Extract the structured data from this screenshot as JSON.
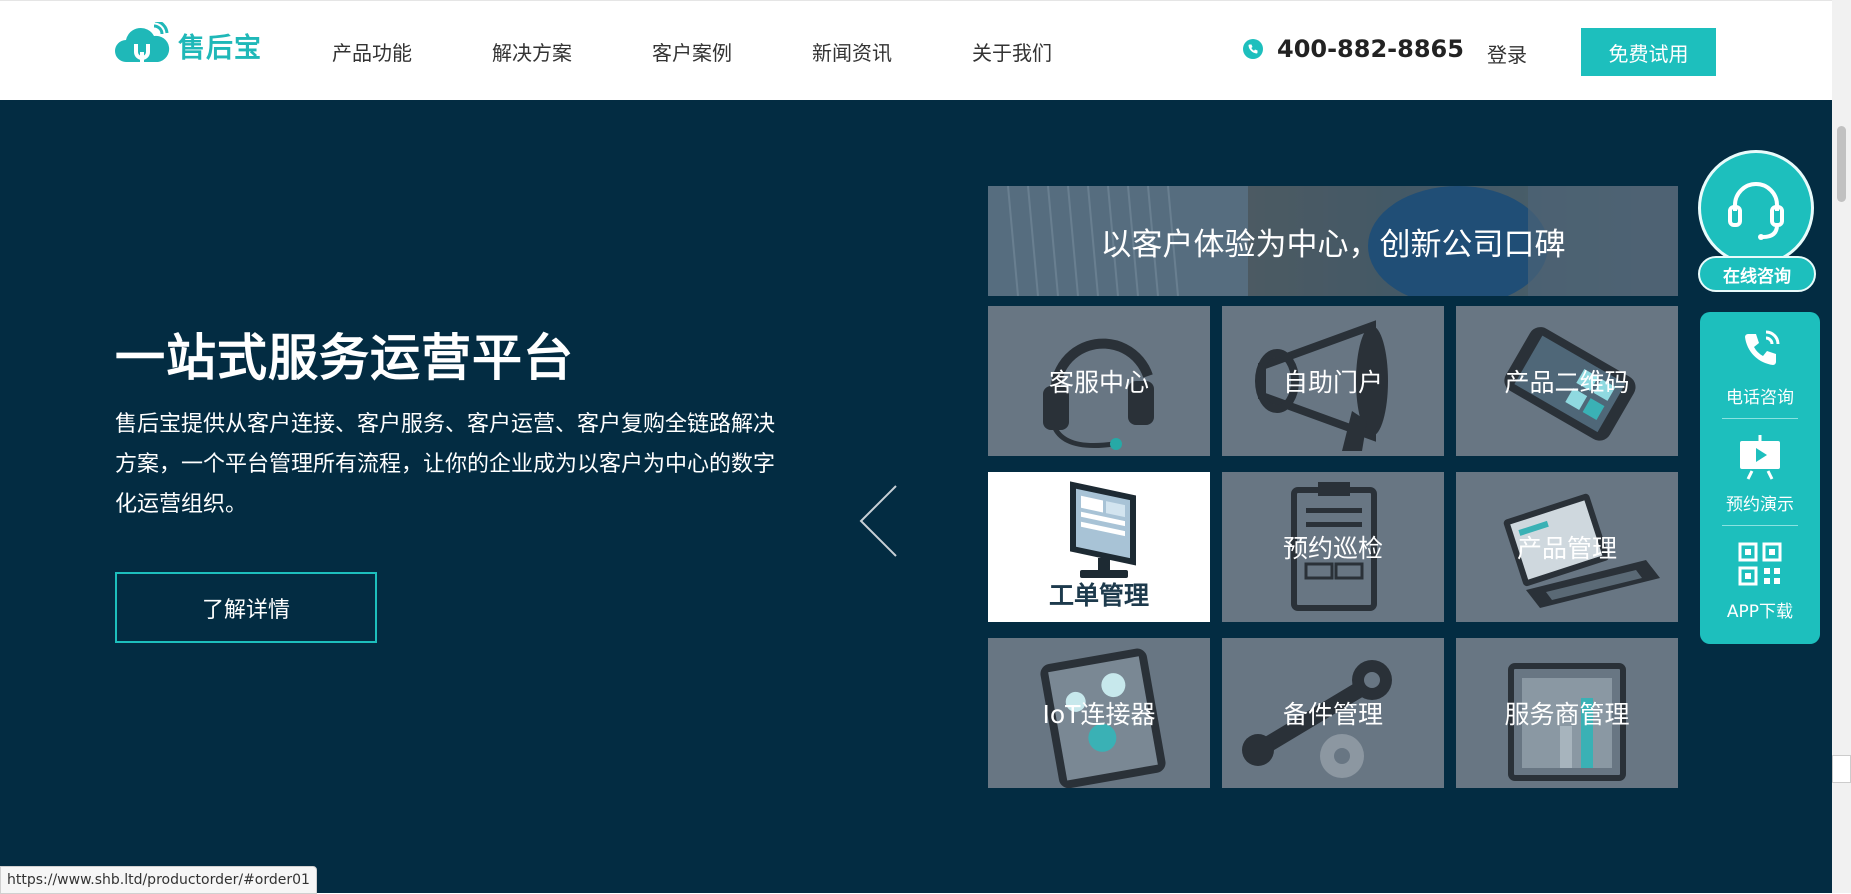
{
  "header": {
    "logo_text": "售后宝",
    "nav": [
      "产品功能",
      "解决方案",
      "客户案例",
      "新闻资讯",
      "关于我们"
    ],
    "phone": "400-882-8865",
    "login": "登录",
    "trial_button": "免费试用"
  },
  "hero": {
    "title": "一站式服务运营平台",
    "description": "售后宝提供从客户连接、客户服务、客户运营、客户复购全链路解决方案，一个平台管理所有流程，让你的企业成为以客户为中心的数字化运营组织。",
    "learn_more": "了解详情"
  },
  "banner": {
    "text": "以客户体验为中心，创新公司口碑"
  },
  "tiles": [
    {
      "label": "客服中心",
      "icon": "headset-icon"
    },
    {
      "label": "自助门户",
      "icon": "megaphone-icon"
    },
    {
      "label": "产品二维码",
      "icon": "phone-qr-icon"
    },
    {
      "label": "工单管理",
      "icon": "monitor-icon",
      "active": true
    },
    {
      "label": "预约巡检",
      "icon": "clipboard-icon"
    },
    {
      "label": "产品管理",
      "icon": "laptop-icon"
    },
    {
      "label": "IoT连接器",
      "icon": "tablet-icon"
    },
    {
      "label": "备件管理",
      "icon": "wrench-gear-icon"
    },
    {
      "label": "服务商管理",
      "icon": "chart-frame-icon"
    }
  ],
  "floating": {
    "consult": "在线咨询",
    "phone_consult": "电话咨询",
    "demo": "预约演示",
    "app_download": "APP下载"
  },
  "status_bar": {
    "url": "https://www.shb.ltd/productorder/#order01"
  },
  "colors": {
    "accent": "#1dbfbd",
    "hero_bg": "#032c42",
    "tile_bg": "#687683"
  }
}
